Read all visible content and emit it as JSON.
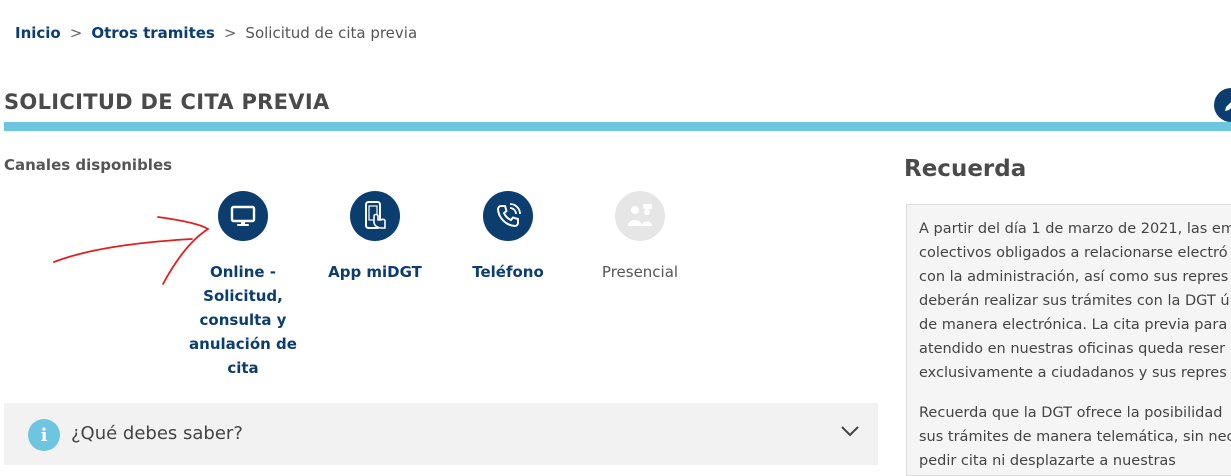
{
  "breadcrumb": {
    "items": [
      "Inicio",
      "Otros tramites"
    ],
    "separator": ">",
    "current": "Solicitud de cita previa"
  },
  "page": {
    "title": "SOLICITUD DE CITA PREVIA",
    "channels_label": "Canales disponibles"
  },
  "channels": [
    {
      "label": "Online - Solicitud, consulta y anulación de cita",
      "icon": "monitor-icon"
    },
    {
      "label": "App miDGT",
      "icon": "mobile-app-icon"
    },
    {
      "label": "Teléfono",
      "icon": "phone-icon"
    },
    {
      "label": "Presencial",
      "icon": "in-person-icon",
      "state": "disabled"
    }
  ],
  "accordion": {
    "title": "¿Qué debes saber?",
    "icon": "info-icon"
  },
  "aside": {
    "title": "Recuerda",
    "paragraph1": [
      "A partir del día 1 de marzo de 2021, las em",
      "colectivos obligados a relacionarse electró",
      "con la administración, así como sus repres",
      "deberán realizar sus trámites con la DGT ú",
      "de manera electrónica. La cita previa para",
      "atendido en nuestras oficinas queda reser",
      "exclusivamente a ciudadanos y sus repres"
    ],
    "paragraph2": [
      "Recuerda que la DGT ofrece la posibilidad",
      "sus trámites de manera telemática, sin nec",
      "pedir cita ni desplazarte a nuestras"
    ]
  },
  "colors": {
    "brand_navy": "#0b3d6e",
    "accent_cyan": "#6ec5e0",
    "annotation_red": "#e02020"
  }
}
